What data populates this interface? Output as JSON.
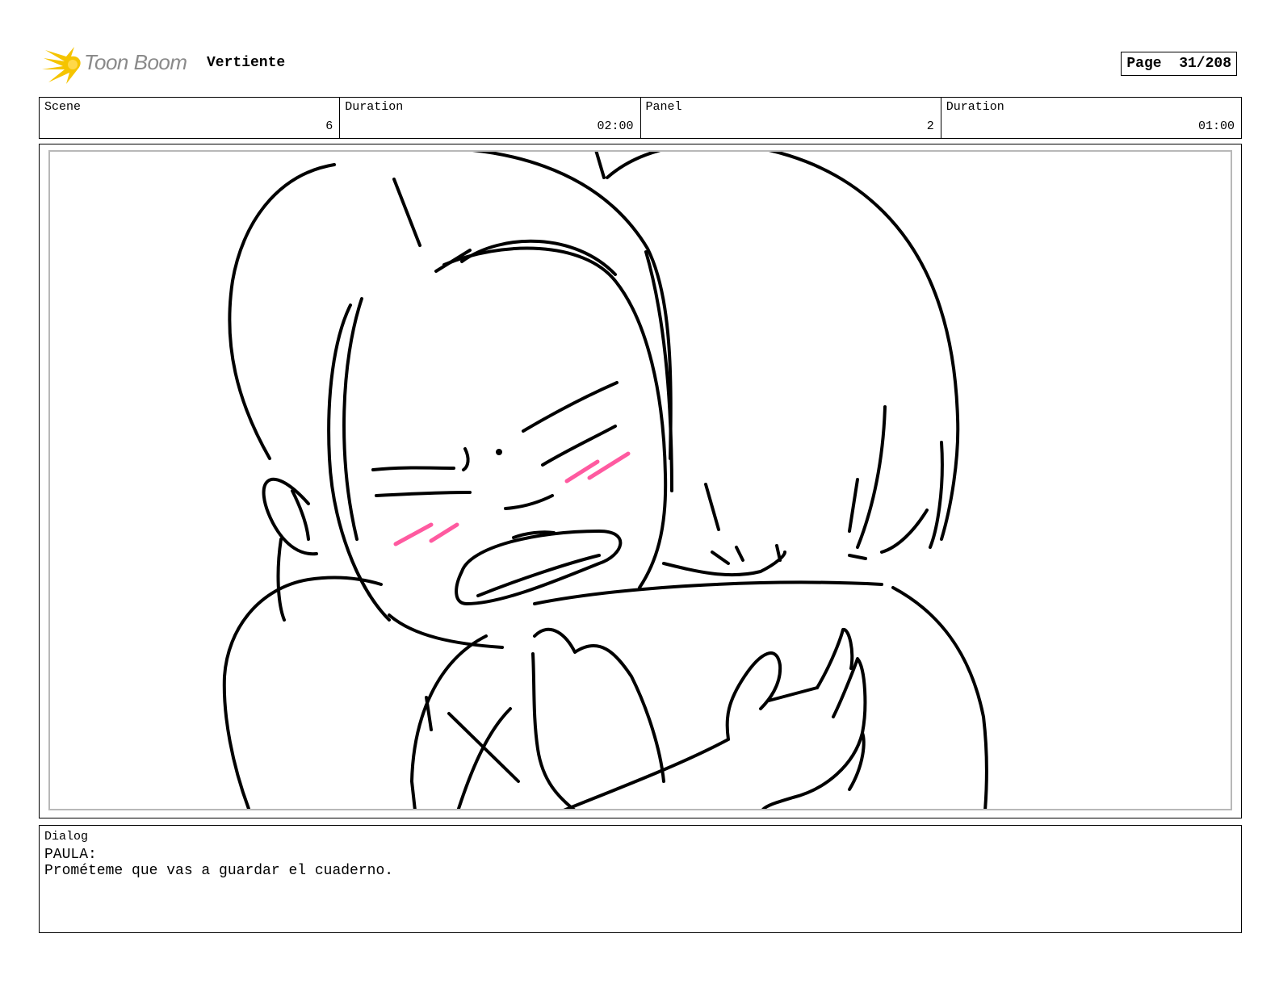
{
  "header": {
    "brand": "Toon Boom",
    "project_title": "Vertiente",
    "page_label": "Page",
    "page_number": "31/208"
  },
  "info": {
    "scene_label": "Scene",
    "scene_value": "6",
    "scene_duration_label": "Duration",
    "scene_duration_value": "02:00",
    "panel_label": "Panel",
    "panel_value": "2",
    "panel_duration_label": "Duration",
    "panel_duration_value": "01:00"
  },
  "dialog": {
    "label": "Dialog",
    "speaker": "PAULA:",
    "line": "Prométeme que vas a guardar el cuaderno."
  },
  "colors": {
    "logo_yellow": "#f5c400",
    "logo_text": "#8a8a8a",
    "blush": "#ff5aa0",
    "panel_border": "#b8b8b8"
  }
}
